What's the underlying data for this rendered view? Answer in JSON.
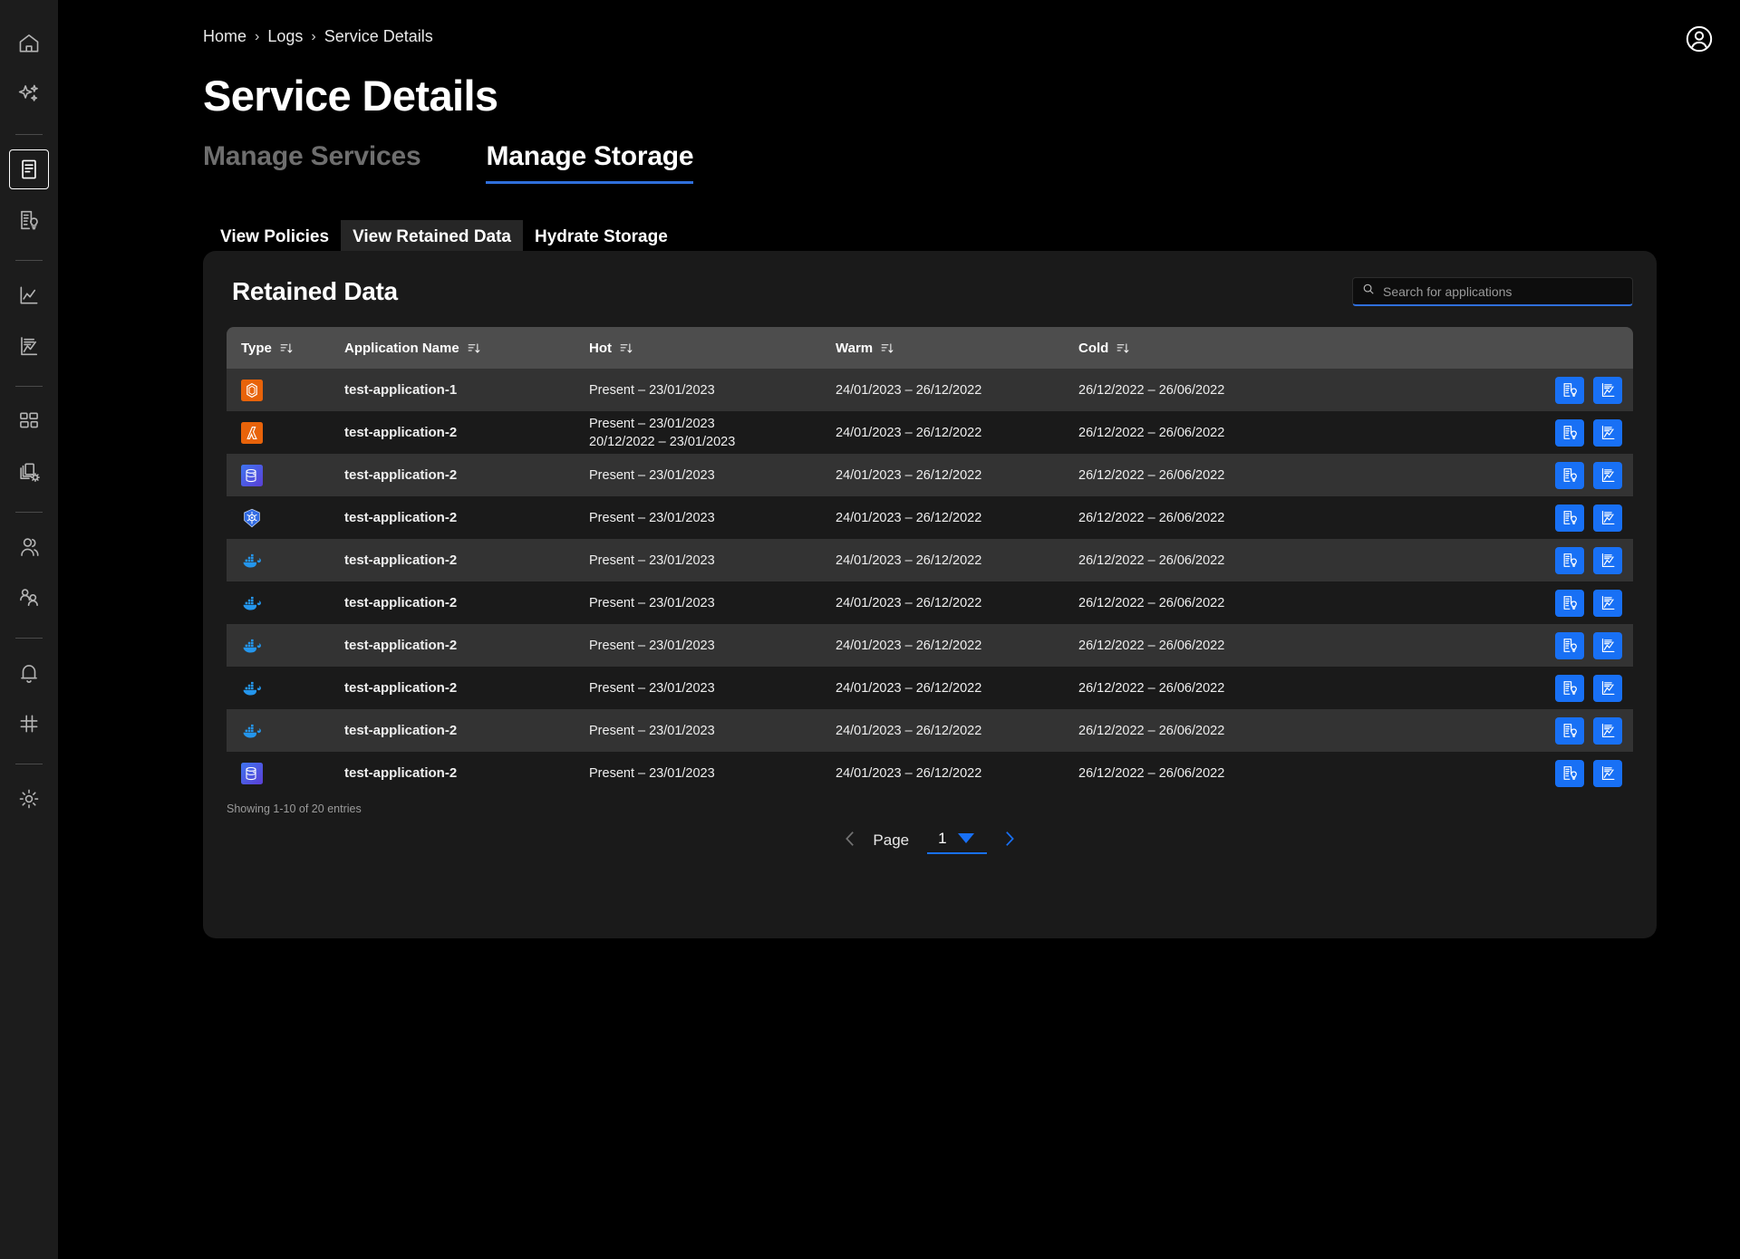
{
  "sidebar": {
    "items": [
      {
        "icon": "home-icon",
        "name": "home",
        "active": false
      },
      {
        "icon": "sparkle-icon",
        "name": "ai-assist",
        "active": false
      },
      {
        "icon": "divider",
        "name": "divider-1",
        "active": false
      },
      {
        "icon": "logs-document-icon",
        "name": "logs",
        "active": true
      },
      {
        "icon": "insights-document-icon",
        "name": "insights",
        "active": false
      },
      {
        "icon": "divider",
        "name": "divider-2",
        "active": false
      },
      {
        "icon": "line-chart-icon",
        "name": "metrics",
        "active": false
      },
      {
        "icon": "report-chart-icon",
        "name": "reports",
        "active": false
      },
      {
        "icon": "divider",
        "name": "divider-3",
        "active": false
      },
      {
        "icon": "dashboard-grid-icon",
        "name": "dashboards",
        "active": false
      },
      {
        "icon": "layers-gear-icon",
        "name": "resources",
        "active": false
      },
      {
        "icon": "divider",
        "name": "divider-4",
        "active": false
      },
      {
        "icon": "users-icon",
        "name": "users",
        "active": false
      },
      {
        "icon": "team-icon",
        "name": "teams",
        "active": false
      },
      {
        "icon": "divider",
        "name": "divider-5",
        "active": false
      },
      {
        "icon": "bell-icon",
        "name": "alerts",
        "active": false
      },
      {
        "icon": "hash-grid-icon",
        "name": "integrations",
        "active": false
      },
      {
        "icon": "divider",
        "name": "divider-6",
        "active": false
      },
      {
        "icon": "gear-icon",
        "name": "settings",
        "active": false
      }
    ]
  },
  "header": {
    "breadcrumb": [
      "Home",
      "Logs",
      "Service Details"
    ],
    "separator": "›",
    "title": "Service Details",
    "account_icon": "account-circle-icon"
  },
  "main_tabs": [
    {
      "label": "Manage Services",
      "active": false
    },
    {
      "label": "Manage Storage",
      "active": true
    }
  ],
  "sub_tabs": [
    {
      "label": "View Policies",
      "active": false
    },
    {
      "label": "View Retained Data",
      "active": true
    },
    {
      "label": "Hydrate Storage",
      "active": false
    }
  ],
  "panel": {
    "title": "Retained Data",
    "search": {
      "placeholder": "Search for applications",
      "value": "",
      "icon": "search-icon"
    },
    "columns": [
      {
        "label": "Type",
        "sort_icon": "sort-descending-icon"
      },
      {
        "label": "Application Name",
        "sort_icon": "sort-descending-icon"
      },
      {
        "label": "Hot",
        "sort_icon": "sort-descending-icon"
      },
      {
        "label": "Warm",
        "sort_icon": "sort-descending-icon"
      },
      {
        "label": "Cold",
        "sort_icon": "sort-descending-icon"
      }
    ],
    "rows": [
      {
        "type_icon": "aws-ec2-icon",
        "name": "test-application-1",
        "hot": [
          "Present – 23/01/2023"
        ],
        "warm": "24/01/2023 – 26/12/2022",
        "cold": "26/12/2022 – 26/06/2022"
      },
      {
        "type_icon": "aws-lambda-icon",
        "name": "test-application-2",
        "hot": [
          "Present – 23/01/2023",
          "20/12/2022 – 23/01/2023"
        ],
        "warm": "24/01/2023 – 26/12/2022",
        "cold": "26/12/2022 – 26/06/2022"
      },
      {
        "type_icon": "azure-database-icon",
        "name": "test-application-2",
        "hot": [
          "Present – 23/01/2023"
        ],
        "warm": "24/01/2023 – 26/12/2022",
        "cold": "26/12/2022 – 26/06/2022"
      },
      {
        "type_icon": "kubernetes-icon",
        "name": "test-application-2",
        "hot": [
          "Present – 23/01/2023"
        ],
        "warm": "24/01/2023 – 26/12/2022",
        "cold": "26/12/2022 – 26/06/2022"
      },
      {
        "type_icon": "docker-icon",
        "name": "test-application-2",
        "hot": [
          "Present – 23/01/2023"
        ],
        "warm": "24/01/2023 – 26/12/2022",
        "cold": "26/12/2022 – 26/06/2022"
      },
      {
        "type_icon": "docker-icon",
        "name": "test-application-2",
        "hot": [
          "Present – 23/01/2023"
        ],
        "warm": "24/01/2023 – 26/12/2022",
        "cold": "26/12/2022 – 26/06/2022"
      },
      {
        "type_icon": "docker-icon",
        "name": "test-application-2",
        "hot": [
          "Present – 23/01/2023"
        ],
        "warm": "24/01/2023 – 26/12/2022",
        "cold": "26/12/2022 – 26/06/2022"
      },
      {
        "type_icon": "docker-icon",
        "name": "test-application-2",
        "hot": [
          "Present – 23/01/2023"
        ],
        "warm": "24/01/2023 – 26/12/2022",
        "cold": "26/12/2022 – 26/06/2022"
      },
      {
        "type_icon": "docker-icon",
        "name": "test-application-2",
        "hot": [
          "Present – 23/01/2023"
        ],
        "warm": "24/01/2023 – 26/12/2022",
        "cold": "26/12/2022 – 26/06/2022"
      },
      {
        "type_icon": "azure-database-icon",
        "name": "test-application-2",
        "hot": [
          "Present – 23/01/2023"
        ],
        "warm": "24/01/2023 – 26/12/2022",
        "cold": "26/12/2022 – 26/06/2022"
      }
    ],
    "row_actions": [
      {
        "icon": "document-insight-icon",
        "name": "view-insights-button"
      },
      {
        "icon": "document-chart-icon",
        "name": "view-analytics-button"
      }
    ],
    "footer": {
      "showing": "Showing 1-10 of 20 entries",
      "page_label": "Page",
      "page_value": "1",
      "prev_icon": "chevron-left-icon",
      "next_icon": "chevron-right-icon",
      "caret_icon": "caret-down-icon"
    }
  },
  "colors": {
    "accent_blue": "#1870f5",
    "tab_underline": "#2f6fdb",
    "header_row": "#4d4d4d",
    "row_odd": "#333333",
    "row_even": "#1a1a1a",
    "panel_bg": "#1a1a1a",
    "page_bg": "#000000",
    "sidebar_bg": "#1c1c1c"
  }
}
